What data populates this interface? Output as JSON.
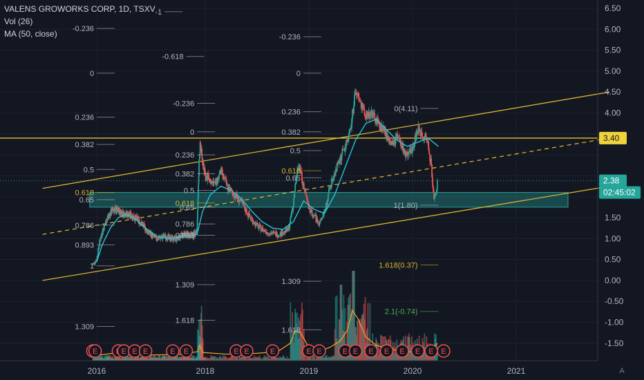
{
  "header": {
    "title": "VALENS GROWORKS CORP, 1D, TSXV",
    "volume_label": "Vol (26)",
    "ma_label": "MA (50, close)"
  },
  "colors": {
    "background": "#131722",
    "up": "#26a69a",
    "down": "#ef5350",
    "ma": "#26c6da",
    "trend": "#d8b331",
    "zone": "#26a69a",
    "fib_label": "#b2b5be",
    "fib_gold": "#d8b331",
    "fib_green": "#4caf50"
  },
  "chart_data": {
    "type": "candlestick",
    "x_axis": {
      "labels": [
        "2016",
        "2018",
        "2019",
        "2020",
        "2021"
      ],
      "years": [
        2016,
        2018,
        2019,
        2020,
        2021
      ]
    },
    "y_axis": {
      "ticks": [
        6.5,
        6.0,
        5.5,
        5.0,
        4.5,
        4.0,
        3.5,
        3.0,
        2.5,
        2.0,
        1.5,
        1.0,
        0.5,
        0.0,
        -0.5,
        -1.0,
        -1.5
      ],
      "tick_labels": [
        "6.50",
        "6.00",
        "5.50",
        "5.00",
        "4.50",
        "4.00",
        "",
        "",
        "",
        "",
        "1.50",
        "1.00",
        "0.50",
        "0.00",
        "-0.50",
        "-1.00",
        "-1.50"
      ],
      "range": [
        -1.8,
        6.6
      ]
    },
    "price_markers": [
      {
        "label": "3.40",
        "value": 3.4,
        "style": "gold"
      },
      {
        "label": "2.38",
        "value": 2.38,
        "style": "teal"
      },
      {
        "label": "02:45:02",
        "value": 2.1,
        "style": "teal"
      }
    ],
    "horizontal_line": 3.4,
    "current_price_line": 2.38,
    "support_zone": {
      "low": 1.75,
      "high": 2.1,
      "from": 2015.87,
      "to": 2021.5
    },
    "trend_lines": [
      {
        "x": [
          2015.0,
          2021.9
        ],
        "y": [
          2.2,
          4.5
        ],
        "style": "solid"
      },
      {
        "x": [
          2015.0,
          2021.9
        ],
        "y": [
          0.0,
          2.25
        ],
        "style": "solid"
      },
      {
        "x": [
          2015.0,
          2021.9
        ],
        "y": [
          1.1,
          3.4
        ],
        "style": "dashed"
      }
    ],
    "price_path": [
      [
        2015.93,
        0.38
      ],
      [
        2016.0,
        0.5
      ],
      [
        2016.05,
        0.9
      ],
      [
        2016.1,
        1.15
      ],
      [
        2016.2,
        1.5
      ],
      [
        2016.3,
        1.7
      ],
      [
        2016.4,
        1.65
      ],
      [
        2016.5,
        1.6
      ],
      [
        2016.65,
        1.55
      ],
      [
        2016.8,
        1.4
      ],
      [
        2016.95,
        1.15
      ],
      [
        2017.1,
        1.0
      ],
      [
        2017.25,
        1.05
      ],
      [
        2017.45,
        0.98
      ],
      [
        2017.6,
        1.1
      ],
      [
        2017.78,
        1.08
      ],
      [
        2017.85,
        1.2
      ],
      [
        2017.88,
        2.6
      ],
      [
        2017.91,
        3.3
      ],
      [
        2017.95,
        2.8
      ],
      [
        2018.0,
        2.5
      ],
      [
        2018.1,
        2.3
      ],
      [
        2018.15,
        2.6
      ],
      [
        2018.22,
        2.2
      ],
      [
        2018.3,
        2.0
      ],
      [
        2018.35,
        1.85
      ],
      [
        2018.42,
        1.55
      ],
      [
        2018.5,
        1.3
      ],
      [
        2018.6,
        1.15
      ],
      [
        2018.7,
        1.1
      ],
      [
        2018.8,
        1.2
      ],
      [
        2018.85,
        1.8
      ],
      [
        2018.88,
        2.5
      ],
      [
        2018.91,
        2.8
      ],
      [
        2018.95,
        2.2
      ],
      [
        2019.0,
        1.7
      ],
      [
        2019.05,
        1.55
      ],
      [
        2019.1,
        1.35
      ],
      [
        2019.15,
        1.6
      ],
      [
        2019.2,
        2.2
      ],
      [
        2019.25,
        2.6
      ],
      [
        2019.3,
        2.9
      ],
      [
        2019.35,
        3.2
      ],
      [
        2019.4,
        3.6
      ],
      [
        2019.45,
        4.5
      ],
      [
        2019.5,
        4.2
      ],
      [
        2019.55,
        3.95
      ],
      [
        2019.6,
        4.0
      ],
      [
        2019.65,
        3.8
      ],
      [
        2019.72,
        3.6
      ],
      [
        2019.8,
        3.2
      ],
      [
        2019.85,
        3.4
      ],
      [
        2019.92,
        3.1
      ],
      [
        2019.95,
        2.9
      ],
      [
        2020.0,
        3.2
      ],
      [
        2020.05,
        3.6
      ],
      [
        2020.1,
        3.5
      ],
      [
        2020.15,
        3.3
      ],
      [
        2020.18,
        2.7
      ],
      [
        2020.21,
        1.9
      ],
      [
        2020.24,
        2.38
      ]
    ],
    "ma_path": [
      [
        2016.0,
        0.45
      ],
      [
        2016.1,
        0.85
      ],
      [
        2016.25,
        1.25
      ],
      [
        2016.4,
        1.5
      ],
      [
        2016.55,
        1.58
      ],
      [
        2016.7,
        1.48
      ],
      [
        2016.9,
        1.25
      ],
      [
        2017.1,
        1.05
      ],
      [
        2017.35,
        1.0
      ],
      [
        2017.6,
        1.05
      ],
      [
        2017.85,
        1.1
      ],
      [
        2017.95,
        1.65
      ],
      [
        2018.05,
        2.05
      ],
      [
        2018.15,
        2.25
      ],
      [
        2018.25,
        2.15
      ],
      [
        2018.35,
        1.95
      ],
      [
        2018.45,
        1.65
      ],
      [
        2018.55,
        1.4
      ],
      [
        2018.65,
        1.25
      ],
      [
        2018.75,
        1.22
      ],
      [
        2018.85,
        1.4
      ],
      [
        2018.95,
        1.9
      ],
      [
        2019.05,
        1.7
      ],
      [
        2019.15,
        1.6
      ],
      [
        2019.25,
        2.05
      ],
      [
        2019.35,
        2.7
      ],
      [
        2019.45,
        3.35
      ],
      [
        2019.55,
        3.75
      ],
      [
        2019.65,
        3.85
      ],
      [
        2019.75,
        3.6
      ],
      [
        2019.85,
        3.35
      ],
      [
        2019.95,
        3.2
      ],
      [
        2020.05,
        3.3
      ],
      [
        2020.15,
        3.4
      ],
      [
        2020.25,
        3.2
      ]
    ],
    "volume_overlay": [
      [
        2015.93,
        -1.8
      ],
      [
        2016.3,
        -1.74
      ],
      [
        2016.6,
        -1.76
      ],
      [
        2017.0,
        -1.78
      ],
      [
        2017.5,
        -1.77
      ],
      [
        2017.86,
        -1.7
      ],
      [
        2017.9,
        -1.55
      ],
      [
        2017.95,
        -1.72
      ],
      [
        2018.2,
        -1.76
      ],
      [
        2018.5,
        -1.74
      ],
      [
        2018.7,
        -1.7
      ],
      [
        2018.82,
        -1.5
      ],
      [
        2018.87,
        -1.2
      ],
      [
        2018.92,
        -1.25
      ],
      [
        2019.0,
        -1.6
      ],
      [
        2019.1,
        -1.7
      ],
      [
        2019.2,
        -1.6
      ],
      [
        2019.3,
        -1.45
      ],
      [
        2019.37,
        -1.2
      ],
      [
        2019.42,
        -0.72
      ],
      [
        2019.47,
        -0.9
      ],
      [
        2019.55,
        -1.35
      ],
      [
        2019.65,
        -1.55
      ],
      [
        2019.8,
        -1.65
      ],
      [
        2019.95,
        -1.7
      ],
      [
        2020.1,
        -1.72
      ],
      [
        2020.2,
        -1.6
      ],
      [
        2020.24,
        -1.5
      ]
    ],
    "fib_labels": [
      {
        "text": "-1",
        "x": 2017.2,
        "y": 6.42,
        "color": "fib_label"
      },
      {
        "text": "-0.236",
        "x": 2015.95,
        "y": 6.02,
        "color": "fib_label"
      },
      {
        "text": "-0.236",
        "x": 2018.92,
        "y": 5.82,
        "color": "fib_label"
      },
      {
        "text": "-0.618",
        "x": 2017.6,
        "y": 5.35,
        "color": "fib_label"
      },
      {
        "text": "0",
        "x": 2015.95,
        "y": 4.95,
        "color": "fib_label"
      },
      {
        "text": "0",
        "x": 2018.92,
        "y": 4.95,
        "color": "fib_label"
      },
      {
        "text": "-0.236",
        "x": 2017.8,
        "y": 4.23,
        "color": "fib_label"
      },
      {
        "text": "0.236",
        "x": 2018.92,
        "y": 4.03,
        "color": "fib_label"
      },
      {
        "text": "0(4.11)",
        "x": 2020.05,
        "y": 4.11,
        "color": "fib_label"
      },
      {
        "text": "0.236",
        "x": 2015.95,
        "y": 3.9,
        "color": "fib_label"
      },
      {
        "text": "0",
        "x": 2017.8,
        "y": 3.55,
        "color": "fib_label"
      },
      {
        "text": "0.382",
        "x": 2018.92,
        "y": 3.55,
        "color": "fib_label"
      },
      {
        "text": "0.382",
        "x": 2015.95,
        "y": 3.25,
        "color": "fib_label"
      },
      {
        "text": "0.5",
        "x": 2018.92,
        "y": 3.1,
        "color": "fib_label"
      },
      {
        "text": "0.236",
        "x": 2017.8,
        "y": 3.0,
        "color": "fib_label"
      },
      {
        "text": "0.5",
        "x": 2015.95,
        "y": 2.65,
        "color": "fib_label"
      },
      {
        "text": "0.618",
        "x": 2018.92,
        "y": 2.62,
        "color": "fib_gold"
      },
      {
        "text": "0.382",
        "x": 2017.8,
        "y": 2.55,
        "color": "fib_label"
      },
      {
        "text": "0.65",
        "x": 2018.92,
        "y": 2.45,
        "color": "fib_label"
      },
      {
        "text": "0.5",
        "x": 2017.8,
        "y": 2.15,
        "color": "fib_label"
      },
      {
        "text": "0.618",
        "x": 2015.95,
        "y": 2.1,
        "color": "fib_gold"
      },
      {
        "text": "0.65",
        "x": 2015.95,
        "y": 1.93,
        "color": "fib_label"
      },
      {
        "text": "0.618",
        "x": 2017.8,
        "y": 1.85,
        "color": "fib_gold"
      },
      {
        "text": "0.65",
        "x": 2017.8,
        "y": 1.75,
        "color": "fib_label"
      },
      {
        "text": "1(1.80)",
        "x": 2020.05,
        "y": 1.8,
        "color": "fib_label"
      },
      {
        "text": "0.786",
        "x": 2015.95,
        "y": 1.32,
        "color": "fib_label"
      },
      {
        "text": "0.786",
        "x": 2017.8,
        "y": 1.35,
        "color": "fib_label"
      },
      {
        "text": "0.893",
        "x": 2015.95,
        "y": 0.85,
        "color": "fib_label"
      },
      {
        "text": "0.893",
        "x": 2017.8,
        "y": 1.08,
        "color": "fib_label"
      },
      {
        "text": "1",
        "x": 2015.95,
        "y": 0.35,
        "color": "fib_label"
      },
      {
        "text": "1.618(0.37)",
        "x": 2020.05,
        "y": 0.37,
        "color": "fib_gold"
      },
      {
        "text": "1.309",
        "x": 2017.8,
        "y": -0.1,
        "color": "fib_label"
      },
      {
        "text": "1.309",
        "x": 2018.92,
        "y": -0.02,
        "color": "fib_label"
      },
      {
        "text": "2.1(-0.74)",
        "x": 2020.05,
        "y": -0.74,
        "color": "fib_green"
      },
      {
        "text": "1.618",
        "x": 2017.8,
        "y": -0.95,
        "color": "fib_label"
      },
      {
        "text": "1.309",
        "x": 2015.95,
        "y": -1.1,
        "color": "fib_label"
      },
      {
        "text": "1.618",
        "x": 2018.92,
        "y": -1.18,
        "color": "fib_label"
      }
    ],
    "earnings_markers": {
      "label": "E",
      "x": [
        2015.93,
        2015.97,
        2016.4,
        2016.5,
        2016.7,
        2016.9,
        2017.4,
        2017.65,
        2018.3,
        2018.4,
        2018.65,
        2019.0,
        2019.1,
        2019.35,
        2019.45,
        2019.6,
        2019.75,
        2019.9,
        2020.05,
        2020.18,
        2020.3
      ]
    }
  }
}
